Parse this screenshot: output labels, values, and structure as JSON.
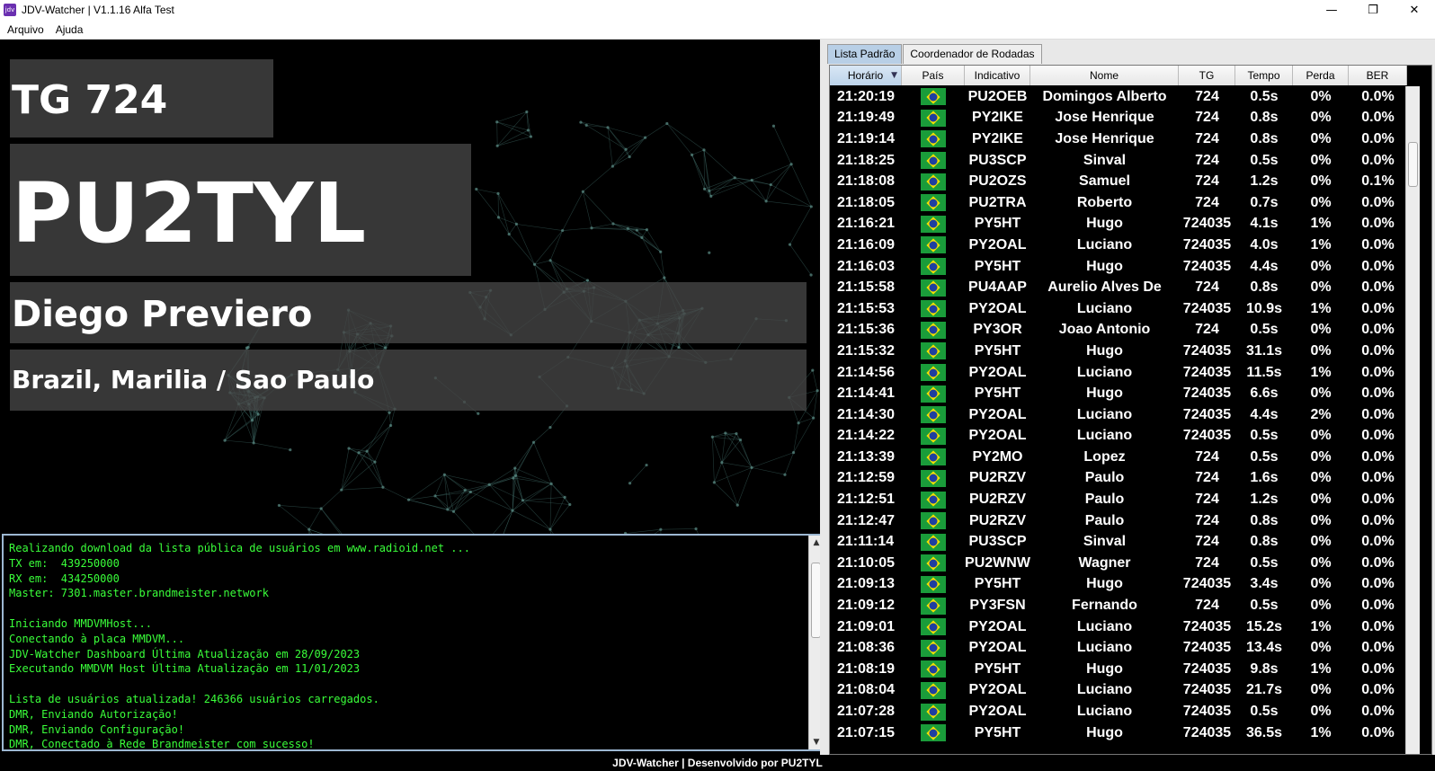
{
  "window": {
    "title": "JDV-Watcher | V1.1.16 Alfa Test",
    "icon_text": "jdv",
    "controls": [
      "minimize-icon",
      "maximize-icon",
      "close-icon"
    ]
  },
  "menu": [
    "Arquivo",
    "Ajuda"
  ],
  "display": {
    "tg": "TG 724",
    "callsign": "PU2TYL",
    "name": "Diego Previero",
    "location": "Brazil, Marilia / Sao Paulo"
  },
  "console": {
    "lines": [
      "Realizando download da lista pública de usuários em www.radioid.net ...",
      "TX em:  439250000",
      "RX em:  434250000",
      "Master: 7301.master.brandmeister.network",
      "",
      "Iniciando MMDVMHost...",
      "Conectando à placa MMDVM...",
      "JDV-Watcher Dashboard Última Atualização em 28/09/2023",
      "Executando MMDVM Host Última Atualização em 11/01/2023",
      "",
      "Lista de usuários atualizada! 246366 usuários carregados.",
      "DMR, Enviando Autorização!",
      "DMR, Enviando Configuração!",
      "DMR, Conectado à Rede Brandmeister com sucesso!"
    ],
    "scrollbar": {
      "up": "▲",
      "down": "▼"
    }
  },
  "footer": "JDV-Watcher | Desenvolvido por PU2TYL",
  "tabs": [
    {
      "label": "Lista Padrão",
      "active": true
    },
    {
      "label": "Coordenador de Rodadas",
      "active": false
    }
  ],
  "table": {
    "columns": [
      "Horário",
      "País",
      "Indicativo",
      "Nome",
      "TG",
      "Tempo",
      "Perda",
      "BER"
    ],
    "sort_column": "Horário",
    "sort_indicator": "▼",
    "rows": [
      [
        "21:20:19",
        "brazil-flag",
        "PU2OEB",
        "Domingos Alberto",
        "724",
        "0.5s",
        "0%",
        "0.0%"
      ],
      [
        "21:19:49",
        "brazil-flag",
        "PY2IKE",
        "Jose Henrique",
        "724",
        "0.8s",
        "0%",
        "0.0%"
      ],
      [
        "21:19:14",
        "brazil-flag",
        "PY2IKE",
        "Jose Henrique",
        "724",
        "0.8s",
        "0%",
        "0.0%"
      ],
      [
        "21:18:25",
        "brazil-flag",
        "PU3SCP",
        "Sinval",
        "724",
        "0.5s",
        "0%",
        "0.0%"
      ],
      [
        "21:18:08",
        "brazil-flag",
        "PU2OZS",
        "Samuel",
        "724",
        "1.2s",
        "0%",
        "0.1%"
      ],
      [
        "21:18:05",
        "brazil-flag",
        "PU2TRA",
        "Roberto",
        "724",
        "0.7s",
        "0%",
        "0.0%"
      ],
      [
        "21:16:21",
        "brazil-flag",
        "PY5HT",
        "Hugo",
        "724035",
        "4.1s",
        "1%",
        "0.0%"
      ],
      [
        "21:16:09",
        "brazil-flag",
        "PY2OAL",
        "Luciano",
        "724035",
        "4.0s",
        "1%",
        "0.0%"
      ],
      [
        "21:16:03",
        "brazil-flag",
        "PY5HT",
        "Hugo",
        "724035",
        "4.4s",
        "0%",
        "0.0%"
      ],
      [
        "21:15:58",
        "brazil-flag",
        "PU4AAP",
        "Aurelio Alves De",
        "724",
        "0.8s",
        "0%",
        "0.0%"
      ],
      [
        "21:15:53",
        "brazil-flag",
        "PY2OAL",
        "Luciano",
        "724035",
        "10.9s",
        "1%",
        "0.0%"
      ],
      [
        "21:15:36",
        "brazil-flag",
        "PY3OR",
        "Joao Antonio",
        "724",
        "0.5s",
        "0%",
        "0.0%"
      ],
      [
        "21:15:32",
        "brazil-flag",
        "PY5HT",
        "Hugo",
        "724035",
        "31.1s",
        "0%",
        "0.0%"
      ],
      [
        "21:14:56",
        "brazil-flag",
        "PY2OAL",
        "Luciano",
        "724035",
        "11.5s",
        "1%",
        "0.0%"
      ],
      [
        "21:14:41",
        "brazil-flag",
        "PY5HT",
        "Hugo",
        "724035",
        "6.6s",
        "0%",
        "0.0%"
      ],
      [
        "21:14:30",
        "brazil-flag",
        "PY2OAL",
        "Luciano",
        "724035",
        "4.4s",
        "2%",
        "0.0%"
      ],
      [
        "21:14:22",
        "brazil-flag",
        "PY2OAL",
        "Luciano",
        "724035",
        "0.5s",
        "0%",
        "0.0%"
      ],
      [
        "21:13:39",
        "brazil-flag",
        "PY2MO",
        "Lopez",
        "724",
        "0.5s",
        "0%",
        "0.0%"
      ],
      [
        "21:12:59",
        "brazil-flag",
        "PU2RZV",
        "Paulo",
        "724",
        "1.6s",
        "0%",
        "0.0%"
      ],
      [
        "21:12:51",
        "brazil-flag",
        "PU2RZV",
        "Paulo",
        "724",
        "1.2s",
        "0%",
        "0.0%"
      ],
      [
        "21:12:47",
        "brazil-flag",
        "PU2RZV",
        "Paulo",
        "724",
        "0.8s",
        "0%",
        "0.0%"
      ],
      [
        "21:11:14",
        "brazil-flag",
        "PU3SCP",
        "Sinval",
        "724",
        "0.8s",
        "0%",
        "0.0%"
      ],
      [
        "21:10:05",
        "brazil-flag",
        "PU2WNW",
        "Wagner",
        "724",
        "0.5s",
        "0%",
        "0.0%"
      ],
      [
        "21:09:13",
        "brazil-flag",
        "PY5HT",
        "Hugo",
        "724035",
        "3.4s",
        "0%",
        "0.0%"
      ],
      [
        "21:09:12",
        "brazil-flag",
        "PY3FSN",
        "Fernando",
        "724",
        "0.5s",
        "0%",
        "0.0%"
      ],
      [
        "21:09:01",
        "brazil-flag",
        "PY2OAL",
        "Luciano",
        "724035",
        "15.2s",
        "1%",
        "0.0%"
      ],
      [
        "21:08:36",
        "brazil-flag",
        "PY2OAL",
        "Luciano",
        "724035",
        "13.4s",
        "0%",
        "0.0%"
      ],
      [
        "21:08:19",
        "brazil-flag",
        "PY5HT",
        "Hugo",
        "724035",
        "9.8s",
        "1%",
        "0.0%"
      ],
      [
        "21:08:04",
        "brazil-flag",
        "PY2OAL",
        "Luciano",
        "724035",
        "21.7s",
        "0%",
        "0.0%"
      ],
      [
        "21:07:28",
        "brazil-flag",
        "PY2OAL",
        "Luciano",
        "724035",
        "0.5s",
        "0%",
        "0.0%"
      ],
      [
        "21:07:15",
        "brazil-flag",
        "PY5HT",
        "Hugo",
        "724035",
        "36.5s",
        "1%",
        "0.0%"
      ]
    ]
  },
  "colors": {
    "console_text": "#3aff3a",
    "active_tab": "#b8cfe6",
    "flag_green": "#1a9c3a",
    "flag_yellow": "#f5e000",
    "flag_blue": "#1f3fa0"
  }
}
